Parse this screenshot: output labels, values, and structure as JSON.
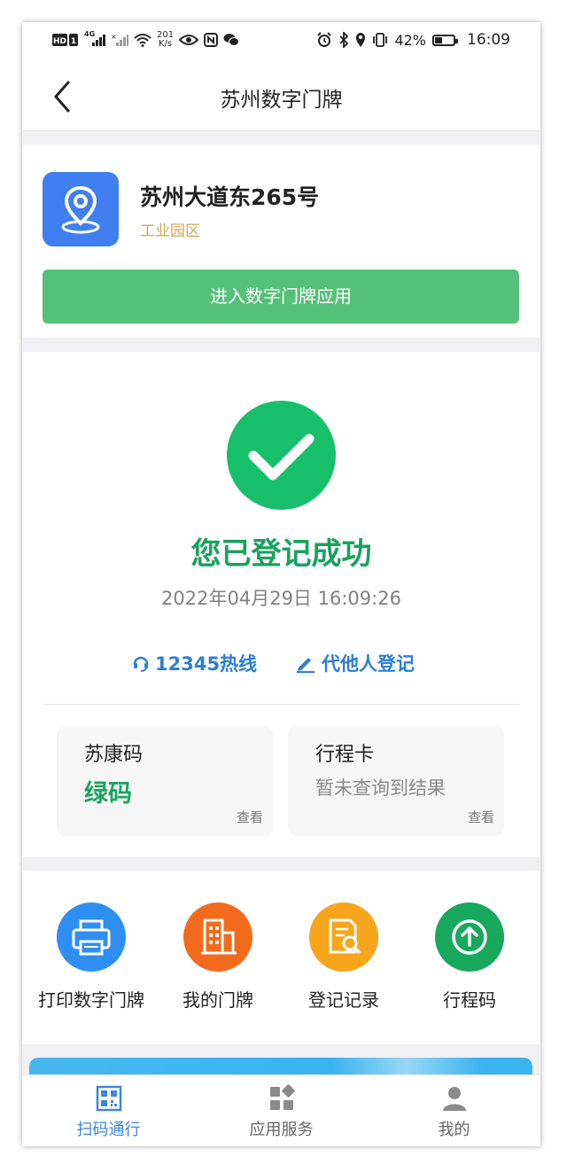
{
  "status_bar": {
    "network_label": "4G",
    "speed_value": "201",
    "speed_unit": "K/s",
    "battery_percent": "42%",
    "battery_level": 0.42,
    "time": "16:09"
  },
  "header": {
    "title": "苏州数字门牌"
  },
  "address": {
    "name": "苏州大道东265号",
    "zone": "工业园区",
    "enter_button": "进入数字门牌应用",
    "icon": "location-pin-icon"
  },
  "registration": {
    "status_text": "您已登记成功",
    "timestamp": "2022年04月29日 16:09:26",
    "hotline_link": "12345热线",
    "register_other_link": "代他人登记"
  },
  "health_cards": [
    {
      "title": "苏康码",
      "value": "绿码",
      "view": "查看"
    },
    {
      "title": "行程卡",
      "value": "暂未查询到结果",
      "view": "查看"
    }
  ],
  "services": [
    {
      "label": "打印数字门牌",
      "icon": "printer-icon",
      "color": "#2f8ff0"
    },
    {
      "label": "我的门牌",
      "icon": "building-icon",
      "color": "#f26b1d"
    },
    {
      "label": "登记记录",
      "icon": "document-search-icon",
      "color": "#f7a51c"
    },
    {
      "label": "行程码",
      "icon": "upload-arrow-icon",
      "color": "#17a85e"
    }
  ],
  "tabs": [
    {
      "label": "扫码通行",
      "icon": "qr-code-icon",
      "active": true
    },
    {
      "label": "应用服务",
      "icon": "apps-grid-icon",
      "active": false
    },
    {
      "label": "我的",
      "icon": "user-icon",
      "active": false
    }
  ],
  "colors": {
    "accent_green": "#55c079",
    "success_green": "#18bf6a",
    "link_blue": "#2b7ed6",
    "zone_gold": "#d4a452",
    "tab_active": "#3e86d9"
  }
}
